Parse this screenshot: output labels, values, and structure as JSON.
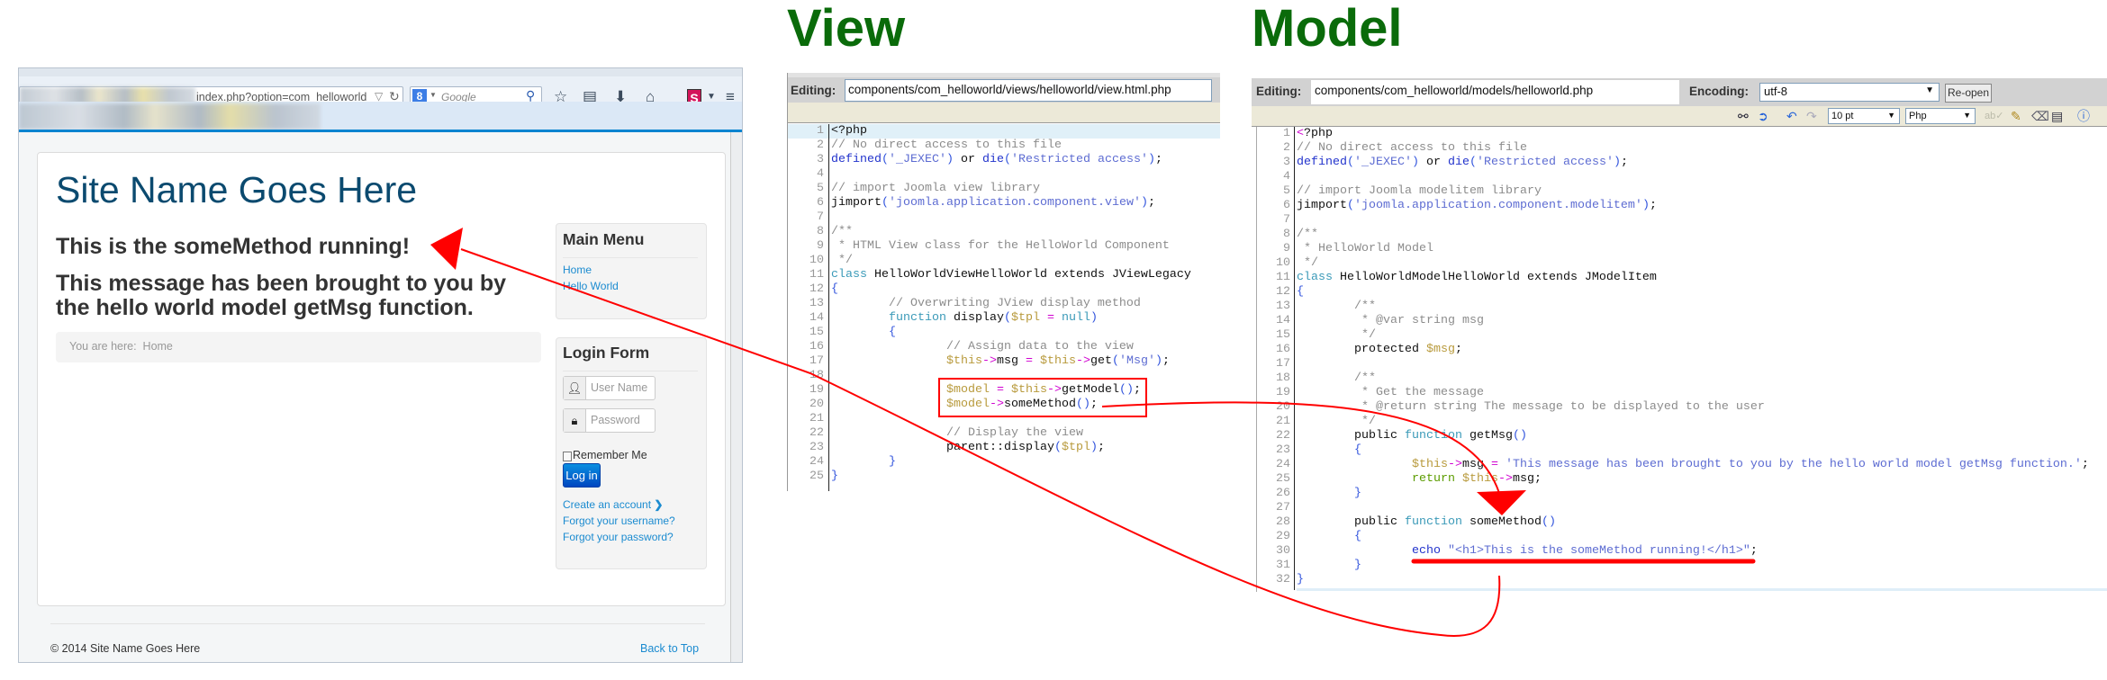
{
  "browser": {
    "url": "index.php?option=com_helloworld",
    "url_dropdown_icon": "▽",
    "reload_icon": "↻",
    "search_engine_icon": "8",
    "search_placeholder": "Google",
    "icons": [
      "star-icon",
      "clipboard-icon",
      "download-icon",
      "home-icon",
      "s-extension-icon",
      "dropdown-icon",
      "menu-icon"
    ],
    "s_label": "S"
  },
  "site": {
    "title": "Site Name Goes Here",
    "h1": "This is the someMethod running!",
    "message_line1": "This message has been brought to you by",
    "message_line2": "the hello world model getMsg function.",
    "breadcrumb": "You are here:  Home",
    "main_menu": {
      "title": "Main Menu",
      "items": [
        "Home",
        "Hello World"
      ]
    },
    "login": {
      "title": "Login Form",
      "username_placeholder": "User Name",
      "password_placeholder": "Password",
      "remember": "Remember Me",
      "button": "Log in",
      "create_account": "Create an account",
      "forgot_username": "Forgot your username?",
      "forgot_password": "Forgot your password?"
    },
    "footer": {
      "copyright": "© 2014 Site Name Goes Here",
      "back_to_top": "Back to Top"
    }
  },
  "view_panel": {
    "heading": "View",
    "editing_label": "Editing:",
    "file_path": "components/com_helloworld/views/helloworld/view.html.php",
    "lines": [
      {
        "n": 1,
        "t": [
          [
            "t",
            "<?php"
          ]
        ]
      },
      {
        "n": 2,
        "t": [
          [
            "c",
            "// No direct access to this file"
          ]
        ]
      },
      {
        "n": 3,
        "t": [
          [
            "f",
            "defined"
          ],
          [
            "p",
            "("
          ],
          [
            "s",
            "'_JEXEC'"
          ],
          [
            "p",
            ")"
          ],
          [
            "t",
            " or "
          ],
          [
            "f",
            "die"
          ],
          [
            "p",
            "("
          ],
          [
            "s",
            "'Restricted access'"
          ],
          [
            "p",
            ")"
          ],
          [
            "t",
            ";"
          ]
        ]
      },
      {
        "n": 4,
        "t": []
      },
      {
        "n": 5,
        "t": [
          [
            "c",
            "// import Joomla view library"
          ]
        ]
      },
      {
        "n": 6,
        "t": [
          [
            "t",
            "jimport"
          ],
          [
            "p",
            "("
          ],
          [
            "s",
            "'joomla.application.component.view'"
          ],
          [
            "p",
            ")"
          ],
          [
            "t",
            ";"
          ]
        ]
      },
      {
        "n": 7,
        "t": []
      },
      {
        "n": 8,
        "t": [
          [
            "c",
            "/**"
          ]
        ]
      },
      {
        "n": 9,
        "t": [
          [
            "c",
            " * HTML View class for the HelloWorld Component"
          ]
        ]
      },
      {
        "n": 10,
        "t": [
          [
            "c",
            " */"
          ]
        ]
      },
      {
        "n": 11,
        "t": [
          [
            "k",
            "class"
          ],
          [
            "t",
            " HelloWorldViewHelloWorld extends JViewLegacy"
          ]
        ]
      },
      {
        "n": 12,
        "t": [
          [
            "p",
            "{"
          ]
        ]
      },
      {
        "n": 13,
        "t": [
          [
            "c",
            "        // Overwriting JView display method"
          ]
        ]
      },
      {
        "n": 14,
        "t": [
          [
            "t",
            "        "
          ],
          [
            "k",
            "function"
          ],
          [
            "t",
            " display"
          ],
          [
            "p",
            "("
          ],
          [
            "v",
            "$tpl"
          ],
          [
            "o",
            " = "
          ],
          [
            "k",
            "null"
          ],
          [
            "p",
            ")"
          ]
        ]
      },
      {
        "n": 15,
        "t": [
          [
            "p",
            "        {"
          ]
        ]
      },
      {
        "n": 16,
        "t": [
          [
            "c",
            "                // Assign data to the view"
          ]
        ]
      },
      {
        "n": 17,
        "t": [
          [
            "t",
            "                "
          ],
          [
            "v",
            "$this"
          ],
          [
            "o",
            "->"
          ],
          [
            "t",
            "msg"
          ],
          [
            "o",
            " = "
          ],
          [
            "v",
            "$this"
          ],
          [
            "o",
            "->"
          ],
          [
            "t",
            "get"
          ],
          [
            "p",
            "("
          ],
          [
            "s",
            "'Msg'"
          ],
          [
            "p",
            ")"
          ],
          [
            "t",
            ";"
          ]
        ]
      },
      {
        "n": 18,
        "t": []
      },
      {
        "n": 19,
        "t": [
          [
            "t",
            "                "
          ],
          [
            "v",
            "$model"
          ],
          [
            "o",
            " = "
          ],
          [
            "v",
            "$this"
          ],
          [
            "o",
            "->"
          ],
          [
            "t",
            "getModel"
          ],
          [
            "p",
            "()"
          ],
          [
            "t",
            ";"
          ]
        ]
      },
      {
        "n": 20,
        "t": [
          [
            "t",
            "                "
          ],
          [
            "v",
            "$model"
          ],
          [
            "o",
            "->"
          ],
          [
            "t",
            "someMethod"
          ],
          [
            "p",
            "()"
          ],
          [
            "t",
            ";"
          ]
        ]
      },
      {
        "n": 21,
        "t": []
      },
      {
        "n": 22,
        "t": [
          [
            "c",
            "                // Display the view"
          ]
        ]
      },
      {
        "n": 23,
        "t": [
          [
            "t",
            "                parent::display"
          ],
          [
            "p",
            "("
          ],
          [
            "v",
            "$tpl"
          ],
          [
            "p",
            ")"
          ],
          [
            "t",
            ";"
          ]
        ]
      },
      {
        "n": 24,
        "t": [
          [
            "p",
            "        }"
          ]
        ]
      },
      {
        "n": 25,
        "t": [
          [
            "p",
            "}"
          ]
        ]
      }
    ]
  },
  "model_panel": {
    "heading": "Model",
    "editing_label": "Editing:",
    "file_path": "components/com_helloworld/models/helloworld.php",
    "encoding_label": "Encoding:",
    "encoding_value": "utf-8",
    "reopen_button": "Re-open",
    "font_size_value": "10 pt",
    "syntax_value": "Php",
    "toolbar_icons": [
      "find-icon",
      "goto-icon",
      "undo-icon",
      "redo-icon",
      "spellcheck-icon",
      "highlight-icon",
      "eraser-icon",
      "word-wrap-icon",
      "help-icon"
    ],
    "lines": [
      {
        "n": 1,
        "t": [
          [
            "o",
            "<"
          ],
          [
            "t",
            "?php"
          ]
        ]
      },
      {
        "n": 2,
        "t": [
          [
            "c",
            "// No direct access to this file"
          ]
        ]
      },
      {
        "n": 3,
        "t": [
          [
            "f",
            "defined"
          ],
          [
            "p",
            "("
          ],
          [
            "s",
            "'_JEXEC'"
          ],
          [
            "p",
            ")"
          ],
          [
            "t",
            " or "
          ],
          [
            "f",
            "die"
          ],
          [
            "p",
            "("
          ],
          [
            "s",
            "'Restricted access'"
          ],
          [
            "p",
            ")"
          ],
          [
            "t",
            ";"
          ]
        ]
      },
      {
        "n": 4,
        "t": []
      },
      {
        "n": 5,
        "t": [
          [
            "c",
            "// import Joomla modelitem library"
          ]
        ]
      },
      {
        "n": 6,
        "t": [
          [
            "t",
            "jimport"
          ],
          [
            "p",
            "("
          ],
          [
            "s",
            "'joomla.application.component.modelitem'"
          ],
          [
            "p",
            ")"
          ],
          [
            "t",
            ";"
          ]
        ]
      },
      {
        "n": 7,
        "t": []
      },
      {
        "n": 8,
        "t": [
          [
            "c",
            "/**"
          ]
        ]
      },
      {
        "n": 9,
        "t": [
          [
            "c",
            " * HelloWorld Model"
          ]
        ]
      },
      {
        "n": 10,
        "t": [
          [
            "c",
            " */"
          ]
        ]
      },
      {
        "n": 11,
        "t": [
          [
            "k",
            "class"
          ],
          [
            "t",
            " HelloWorldModelHelloWorld extends JModelItem"
          ]
        ]
      },
      {
        "n": 12,
        "t": [
          [
            "p",
            "{"
          ]
        ]
      },
      {
        "n": 13,
        "t": [
          [
            "c",
            "        /**"
          ]
        ]
      },
      {
        "n": 14,
        "t": [
          [
            "c",
            "         * @var string msg"
          ]
        ]
      },
      {
        "n": 15,
        "t": [
          [
            "c",
            "         */"
          ]
        ]
      },
      {
        "n": 16,
        "t": [
          [
            "t",
            "        protected "
          ],
          [
            "v",
            "$msg"
          ],
          [
            "t",
            ";"
          ]
        ]
      },
      {
        "n": 17,
        "t": []
      },
      {
        "n": 18,
        "t": [
          [
            "c",
            "        /**"
          ]
        ]
      },
      {
        "n": 19,
        "t": [
          [
            "c",
            "         * Get the message"
          ]
        ]
      },
      {
        "n": 20,
        "t": [
          [
            "c",
            "         * @return string The message to be displayed to the user"
          ]
        ]
      },
      {
        "n": 21,
        "t": [
          [
            "c",
            "         */"
          ]
        ]
      },
      {
        "n": 22,
        "t": [
          [
            "t",
            "        public "
          ],
          [
            "k",
            "function"
          ],
          [
            "t",
            " getMsg"
          ],
          [
            "p",
            "()"
          ]
        ]
      },
      {
        "n": 23,
        "t": [
          [
            "p",
            "        {"
          ]
        ]
      },
      {
        "n": 24,
        "t": [
          [
            "t",
            "                "
          ],
          [
            "v",
            "$this"
          ],
          [
            "o",
            "->"
          ],
          [
            "t",
            "msg"
          ],
          [
            "o",
            " = "
          ],
          [
            "s",
            "'This message has been brought to you by the hello world model getMsg function.'"
          ],
          [
            "t",
            ";"
          ]
        ]
      },
      {
        "n": 25,
        "t": [
          [
            "t",
            "                "
          ],
          [
            "r",
            "return "
          ],
          [
            "v",
            "$this"
          ],
          [
            "o",
            "->"
          ],
          [
            "t",
            "msg;"
          ]
        ]
      },
      {
        "n": 26,
        "t": [
          [
            "p",
            "        }"
          ]
        ]
      },
      {
        "n": 27,
        "t": []
      },
      {
        "n": 28,
        "t": [
          [
            "t",
            "        public "
          ],
          [
            "k",
            "function"
          ],
          [
            "t",
            " someMethod"
          ],
          [
            "p",
            "()"
          ]
        ]
      },
      {
        "n": 29,
        "t": [
          [
            "p",
            "        {"
          ]
        ]
      },
      {
        "n": 30,
        "t": [
          [
            "t",
            "                "
          ],
          [
            "f",
            "echo "
          ],
          [
            "s",
            "\"<h1>This is the someMethod running!</h1>\""
          ],
          [
            "t",
            ";"
          ]
        ]
      },
      {
        "n": 31,
        "t": [
          [
            "p",
            "        }"
          ]
        ]
      },
      {
        "n": 32,
        "t": [
          [
            "p",
            "}"
          ]
        ]
      }
    ]
  },
  "colors": {
    "annotation_red": "#ff0000",
    "heading_green": "#0a6b0a",
    "link_blue": "#1b8bd0",
    "site_title": "#0b4a6f"
  }
}
